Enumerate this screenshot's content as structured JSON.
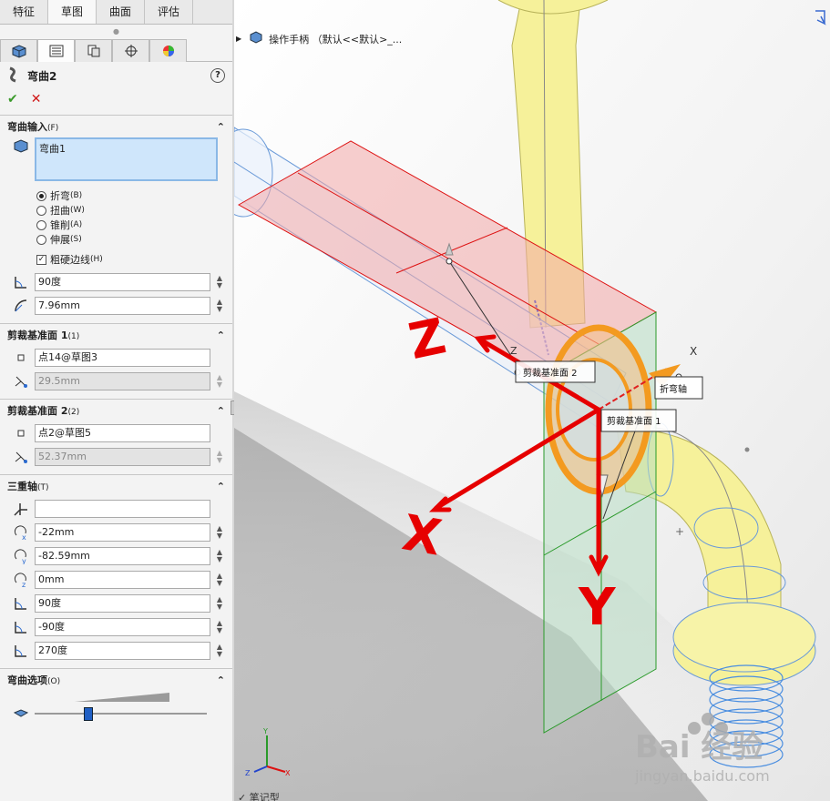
{
  "tabs": [
    "特征",
    "草图",
    "曲面",
    "评估"
  ],
  "active_tab": 1,
  "icon_tabs": [
    "feature-manager-icon",
    "property-manager-icon",
    "configuration-manager-icon",
    "dimxpert-icon",
    "display-manager-icon"
  ],
  "feature": {
    "title": "弯曲2",
    "ok": "✔",
    "cancel": "✕",
    "help": "?"
  },
  "bend_input": {
    "header": "弯曲输入",
    "header_suffix": "(F)",
    "selection": "弯曲1",
    "options": [
      {
        "label": "折弯",
        "key": "(B)",
        "selected": true
      },
      {
        "label": "扭曲",
        "key": "(W)",
        "selected": false
      },
      {
        "label": "锥削",
        "key": "(A)",
        "selected": false
      },
      {
        "label": "伸展",
        "key": "(S)",
        "selected": false
      }
    ],
    "checkbox": {
      "label": "粗硬边线",
      "key": "(H)",
      "checked": true
    },
    "angle": "90度",
    "radius": "7.96mm"
  },
  "trim1": {
    "header": "剪裁基准面 1",
    "suffix": "(1)",
    "ref": "点14@草图3",
    "distance": "29.5mm"
  },
  "trim2": {
    "header": "剪裁基准面 2",
    "suffix": "(2)",
    "ref": "点2@草图5",
    "distance": "52.37mm"
  },
  "triad": {
    "header": "三重轴",
    "suffix": "(T)",
    "ref": "",
    "x": "-22mm",
    "y": "-82.59mm",
    "z": "0mm",
    "rx": "90度",
    "ry": "-90度",
    "rz": "270度"
  },
  "bend_options": {
    "header": "弯曲选项",
    "suffix": "(O)",
    "slider": 0.3
  },
  "viewport": {
    "tree_item": "操作手柄 （默认<<默认>_...",
    "labels": {
      "trim2": "剪裁基准面 2",
      "bend_axis": "折弯轴",
      "trim1": "剪裁基准面 1",
      "x_small": "X",
      "z_small": "Z"
    },
    "handwritten": {
      "z": "Z",
      "x": "X",
      "y": "Y"
    },
    "triad": {
      "x": "X",
      "y": "Y",
      "z": "Z"
    },
    "watermark": {
      "brand": "Bai 经验",
      "url": "jingyan.baidu.com"
    },
    "bottom_text": "✓ 笔记型"
  },
  "colors": {
    "accent_red": "#e60000",
    "part_yellow": "#f6f19a",
    "plane_red": "#f3a8a8",
    "plane_green": "#b7dcc2",
    "selection_blue": "#cfe6fb"
  }
}
